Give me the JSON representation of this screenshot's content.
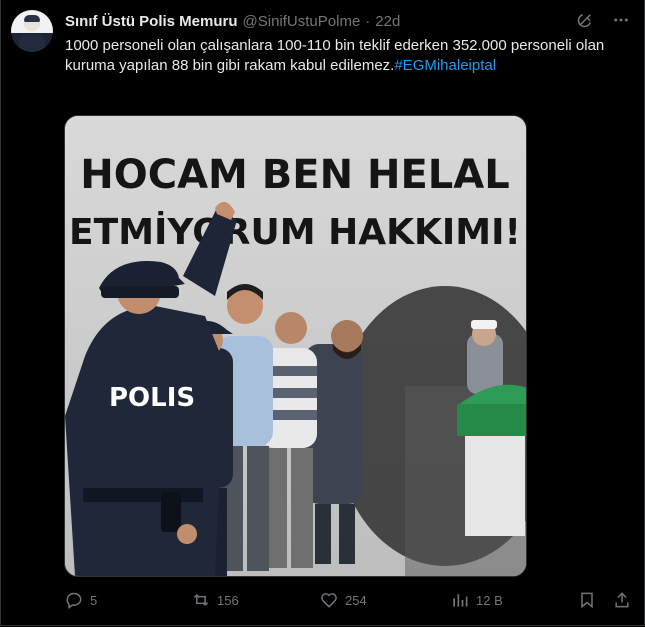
{
  "post": {
    "author_name": "Sınıf Üstü Polis Memuru",
    "author_handle": "@SinifUstuPolme",
    "separator": "·",
    "time": "22d",
    "text": "1000 personeli olan çalışanlara 100-110 bin teklif ederken 352.000 personeli olan kuruma yapılan 88 bin gibi rakam kabul edilemez.",
    "hashtag": "#EGMihaleiptal"
  },
  "media": {
    "headline_line1": "HOCAM BEN HELAL",
    "headline_line2": "ETMİYORUM HAKKIMI!",
    "badge": "POLIS"
  },
  "actions": {
    "replies": "5",
    "reposts": "156",
    "likes": "254",
    "views": "12 B"
  },
  "colors": {
    "background": "#000000",
    "text": "#e7e9ea",
    "muted": "#71767b",
    "accent": "#1d9bf0",
    "border": "#2f3336"
  },
  "icons": [
    "grok-icon",
    "more-icon",
    "reply-icon",
    "repost-icon",
    "like-icon",
    "views-icon",
    "bookmark-icon",
    "share-icon"
  ]
}
